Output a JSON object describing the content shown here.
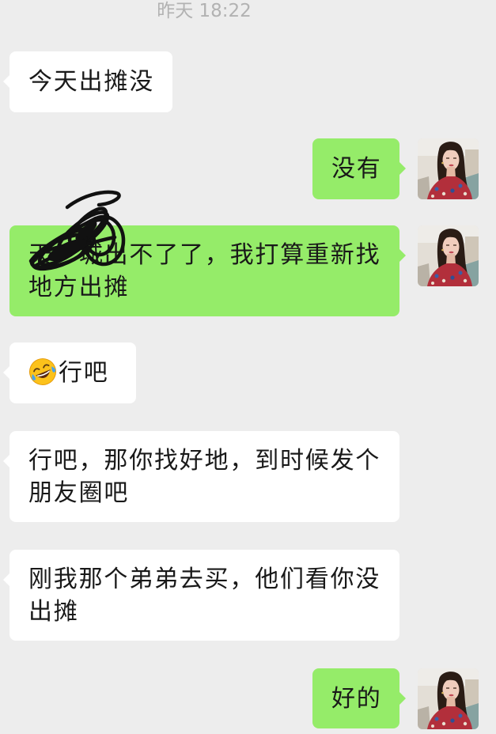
{
  "theme": {
    "background": "#ededed",
    "sent_bubble": "#95ec69",
    "received_bubble": "#ffffff",
    "text": "#191919",
    "timestamp": "#b2b2b2",
    "scribble": "#111111"
  },
  "timestamp": "昨天 18:22",
  "messages": [
    {
      "lines": [
        "今天出摊没"
      ]
    },
    {
      "lines": [
        "没有"
      ],
      "avatar_icon": "user-avatar-icon"
    },
    {
      "lines": [
        [
          "天",
          "城出不了了，我打算重新找"
        ],
        [
          "地方出摊"
        ]
      ],
      "overlay_icon": "scribble-redaction-icon",
      "avatar_icon": "user-avatar-icon"
    },
    {
      "emoji_icon": "rolling-laughing-emoji-icon",
      "lines": [
        "行吧"
      ]
    },
    {
      "lines": [
        "行吧，那你找好地，到时候发个",
        "朋友圈吧"
      ]
    },
    {
      "lines": [
        "刚我那个弟弟去买，他们看你没",
        "出摊"
      ]
    },
    {
      "lines": [
        "好的"
      ],
      "avatar_icon": "user-avatar-icon"
    }
  ]
}
